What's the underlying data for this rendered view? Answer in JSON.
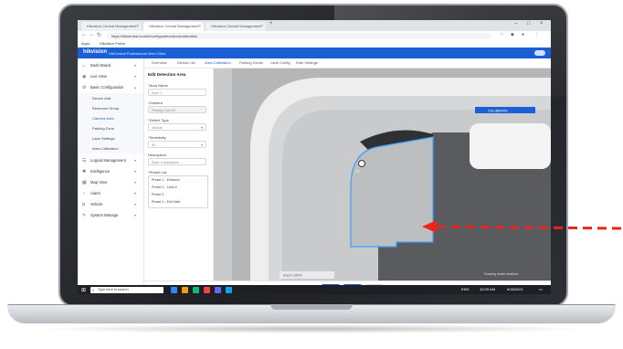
{
  "browser": {
    "tabs": [
      {
        "label": "Hikvision Central Management"
      },
      {
        "label": "Hikvision Central Management"
      },
      {
        "label": "Hikvision Central Management"
      }
    ],
    "url": "https://hikcentral.local/#/configuration/area/calibration",
    "bookmarks": [
      "Apps",
      "Hikvision Portal"
    ]
  },
  "app": {
    "logo": "hikvision",
    "subtitle": "HikCentral Professional Web Client"
  },
  "sidebar": {
    "items": [
      {
        "label": "Dash Board",
        "icon": "home-icon"
      },
      {
        "label": "Live View",
        "icon": "eye-icon"
      },
      {
        "label": "Basic Configuration",
        "icon": "gear-icon"
      },
      {
        "label": "Logical Management",
        "icon": "layers-icon"
      },
      {
        "label": "Intelligence",
        "icon": "brain-icon"
      },
      {
        "label": "Map View",
        "icon": "map-icon"
      },
      {
        "label": "Alarm",
        "icon": "bell-icon"
      },
      {
        "label": "Vehicle",
        "icon": "car-icon"
      },
      {
        "label": "System Manage",
        "icon": "wrench-icon"
      }
    ],
    "subitems": [
      {
        "label": "Device Add"
      },
      {
        "label": "Resource Group"
      },
      {
        "label": "Camera Area"
      },
      {
        "label": "Parking Zone"
      },
      {
        "label": "Lane Settings"
      },
      {
        "label": "Area Calibration"
      }
    ]
  },
  "content_tabs": [
    "Overview",
    "Device List",
    "Area Calibration",
    "Parking Zones",
    "Lane Config",
    "Rule Settings"
  ],
  "panel": {
    "title": "Edit Detection Area",
    "fields": [
      {
        "label": "Area Name",
        "value": "Zone 1"
      },
      {
        "label": "Camera",
        "value": "Parking Cam 03"
      },
      {
        "label": "Detect Type",
        "value": "Vehicle"
      },
      {
        "label": "Sensitivity",
        "value": "50"
      },
      {
        "label": "Description",
        "value": "Enter a description"
      }
    ],
    "list_label": "Preset List",
    "list_items": [
      "Preset 1 - Entrance",
      "Preset 2 - Lane A",
      "Preset 3",
      "Preset 4 - Exit Gate"
    ]
  },
  "canvas": {
    "badge": "CALIBRATE",
    "point_label": "P1",
    "zoom_label": "Zoom 100%",
    "status": "Drawing mode enabled",
    "colors": {
      "outline": "#3aa0ff",
      "asphalt": "#5a5b5e",
      "curb": "#eeeeee",
      "floor": "#bcbdbf"
    }
  },
  "footer": {
    "save": "Save",
    "apply": "Apply",
    "cancel": "Cancel"
  },
  "taskbar": {
    "search_placeholder": "Type here to search",
    "time": "10:25 AM",
    "date": "6/18/2021",
    "lang": "ENG"
  },
  "annotation": {
    "color": "#e8261c"
  }
}
